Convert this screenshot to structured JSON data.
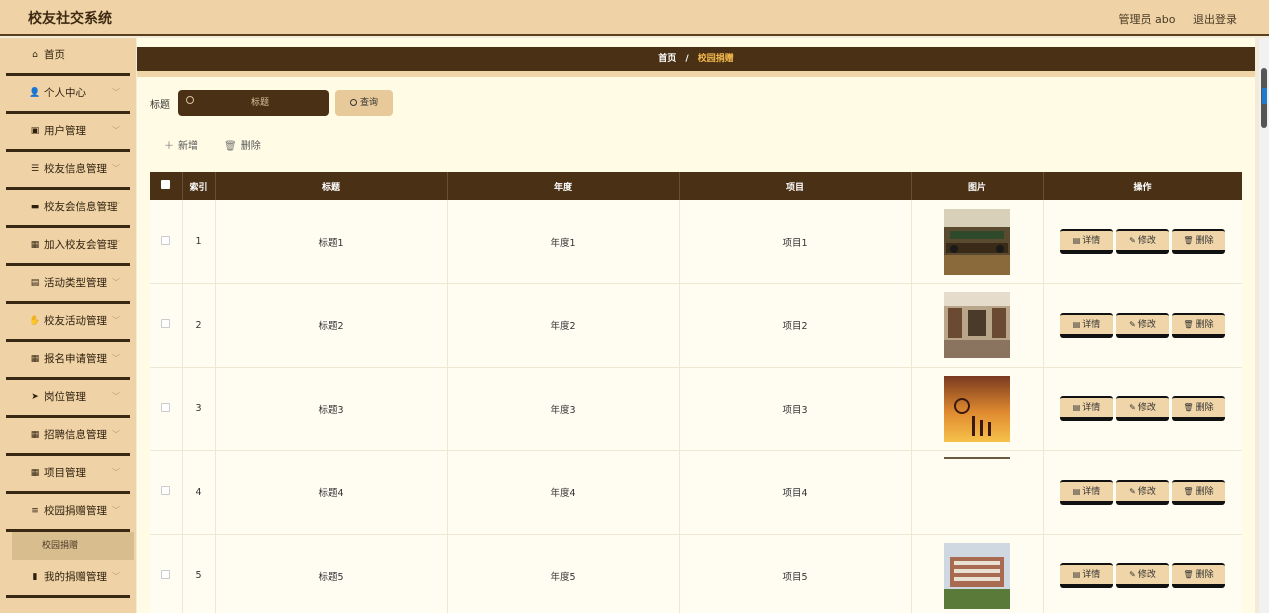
{
  "app": {
    "title": "校友社交系统"
  },
  "header": {
    "user": "管理员 abo",
    "logout": "退出登录"
  },
  "sidebar": {
    "items": [
      {
        "icon": "home-icon",
        "glyph": "⌂",
        "label": "首页",
        "expandable": false
      },
      {
        "icon": "user-icon",
        "glyph": "👤",
        "label": "个人中心",
        "expandable": true
      },
      {
        "icon": "users-icon",
        "glyph": "▣",
        "label": "用户管理",
        "expandable": true
      },
      {
        "icon": "sliders-icon",
        "glyph": "☰",
        "label": "校友信息管理",
        "expandable": true
      },
      {
        "icon": "briefcase-icon",
        "glyph": "▬",
        "label": "校友会信息管理",
        "expandable": true
      },
      {
        "icon": "grid-icon",
        "glyph": "▦",
        "label": "加入校友会管理",
        "expandable": true
      },
      {
        "icon": "clipboard-icon",
        "glyph": "▤",
        "label": "活动类型管理",
        "expandable": true
      },
      {
        "icon": "thumb-icon",
        "glyph": "✋",
        "label": "校友活动管理",
        "expandable": true
      },
      {
        "icon": "grid-icon",
        "glyph": "▦",
        "label": "报名申请管理",
        "expandable": true
      },
      {
        "icon": "send-icon",
        "glyph": "➤",
        "label": "岗位管理",
        "expandable": true
      },
      {
        "icon": "grid-icon",
        "glyph": "▦",
        "label": "招聘信息管理",
        "expandable": true
      },
      {
        "icon": "grid-icon",
        "glyph": "▦",
        "label": "项目管理",
        "expandable": true
      },
      {
        "icon": "list-icon",
        "glyph": "≡",
        "label": "校园捐赠管理",
        "expandable": true,
        "children": [
          "校园捐赠"
        ]
      },
      {
        "icon": "bar-chart-icon",
        "glyph": "▮",
        "label": "我的捐赠管理",
        "expandable": true
      }
    ]
  },
  "breadcrumb": {
    "home": "首页",
    "separator": "/",
    "current": "校园捐赠"
  },
  "search": {
    "label": "标题",
    "placeholder": "标题",
    "button": "查询"
  },
  "actions": {
    "add": "新增",
    "delete": "删除"
  },
  "table": {
    "columns": [
      "索引",
      "标题",
      "年度",
      "项目",
      "图片",
      "操作"
    ],
    "rows": [
      {
        "index": "1",
        "title": "标题1",
        "year": "年度1",
        "project": "项目1",
        "image": "meeting-room"
      },
      {
        "index": "2",
        "title": "标题2",
        "year": "年度2",
        "project": "项目2",
        "image": "library"
      },
      {
        "index": "3",
        "title": "标题3",
        "year": "年度3",
        "project": "项目3",
        "image": "basketball-sunset"
      },
      {
        "index": "4",
        "title": "标题4",
        "year": "年度4",
        "project": "项目4",
        "image": "none"
      },
      {
        "index": "5",
        "title": "标题5",
        "year": "年度5",
        "project": "项目5",
        "image": "campus-building"
      }
    ],
    "row_actions": {
      "detail": "详情",
      "edit": "修改",
      "delete": "删除"
    }
  },
  "colors": {
    "dark": "#4a3015",
    "tan": "#efd3a6",
    "accent": "#f2b84b",
    "bg": "#fffbe4"
  }
}
